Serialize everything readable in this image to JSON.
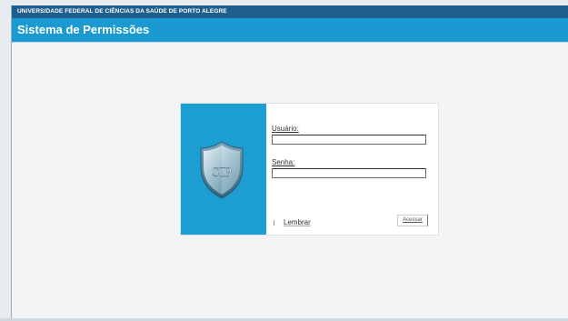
{
  "header": {
    "org_name": "UNIVERSIDADE FEDERAL DE CIÊNCIAS DA SAÚDE DE PORTO ALEGRE",
    "system_title": "Sistema de Permissões"
  },
  "logo": {
    "text": "SIP",
    "icon": "shield-icon"
  },
  "login": {
    "username_label": "Usuário:",
    "username_value": "",
    "password_label": "Senha:",
    "password_value": "",
    "remember_label": "Lembrar",
    "submit_label": "Acessar"
  },
  "colors": {
    "org_bar": "#1f5f8e",
    "title_bar": "#1a9ad0",
    "logo_panel": "#1c9ed3"
  }
}
